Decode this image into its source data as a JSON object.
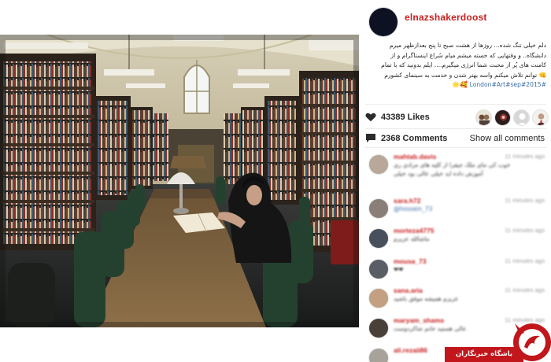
{
  "post": {
    "username": "elnazshakerdoost",
    "caption_lines": [
      "دلم خیلی تنگ شده... روزها از هشت صبح تا پنج بعدازظهر میرم",
      "دانشگاه.. و وقتهایی که خسته میشم میام سُراغ اینستاگرام و از",
      "کامنت های پُر از محبت شما انرژی میگیرم.... ایلم بدونید که با تمام",
      "👊 توانم تلاش میکنم واسه بهتر شدن و خدمت به سینمای کشورم",
      "#London#Art#sep#2015"
    ],
    "caption_emoji": "🥰🌟",
    "likes": "43389 Likes",
    "comments_count": "2368 Comments",
    "show_all": "Show all comments"
  },
  "comments": [
    {
      "user": "mahtab.davis",
      "time": "11 minutes ago",
      "text": "خوب کی مای ملک جیفرا از کلیه های مرادی ری آموزش داده اید خیلی عالی بود خیلی",
      "ltr": false
    },
    {
      "user": "sara.h72",
      "time": "11 minutes ago",
      "text": "@hossein_73",
      "ltr": true
    },
    {
      "user": "morteza4775",
      "time": "11 minutes ago",
      "text": "ماشالله عزیزم",
      "ltr": false
    },
    {
      "user": "mousa_73",
      "time": "11 minutes ago",
      "text": "❤❤",
      "ltr": false
    },
    {
      "user": "sana.aria",
      "time": "11 minutes ago",
      "text": "عزیزم همیشه موفق باشید",
      "ltr": false
    },
    {
      "user": "maryam_shams",
      "time": "11 minutes ago",
      "text": "عالی هستید خانم شاکردوست",
      "ltr": false
    },
    {
      "user": "ali.rezaii86",
      "time": "11 minutes ago",
      "text": "",
      "ltr": false
    }
  ],
  "banner": {
    "text": "باشگاه خبرنگاران"
  },
  "colors": {
    "username": "#c91e1e",
    "hashtag": "#3a6ea8",
    "banner": "#c1161b"
  },
  "icons": {
    "likes": "heart-icon",
    "comments": "comment-bubble-icon",
    "brand": "news-agency-logo"
  }
}
